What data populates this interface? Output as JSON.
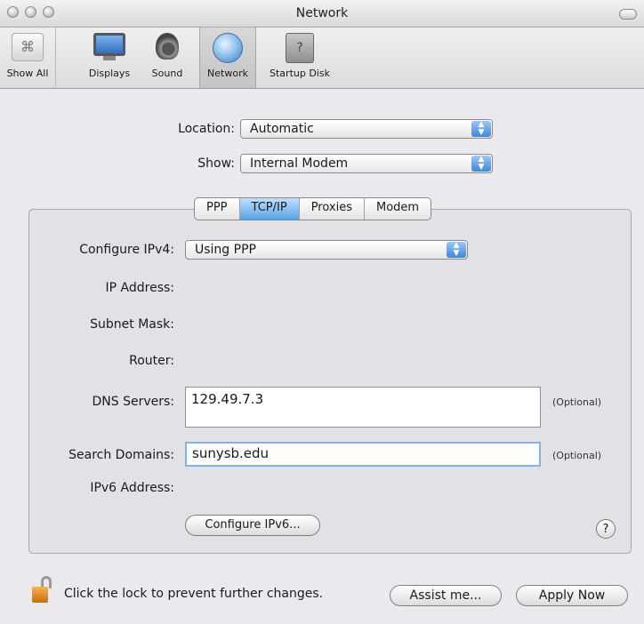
{
  "window": {
    "title": "Network"
  },
  "toolbar": {
    "items": [
      {
        "label": "Show All",
        "icon": "apple-icon"
      },
      {
        "label": "Displays",
        "icon": "display-icon"
      },
      {
        "label": "Sound",
        "icon": "speaker-icon"
      },
      {
        "label": "Network",
        "icon": "network-globe-icon"
      },
      {
        "label": "Startup Disk",
        "icon": "startup-disk-icon"
      }
    ]
  },
  "header": {
    "location_label": "Location:",
    "location_value": "Automatic",
    "show_label": "Show:",
    "show_value": "Internal Modem"
  },
  "tabs": [
    "PPP",
    "TCP/IP",
    "Proxies",
    "Modem"
  ],
  "active_tab": "TCP/IP",
  "form": {
    "configure_ipv4_label": "Configure IPv4:",
    "configure_ipv4_value": "Using PPP",
    "ip_address_label": "IP Address:",
    "subnet_mask_label": "Subnet Mask:",
    "router_label": "Router:",
    "dns_servers_label": "DNS Servers:",
    "dns_servers_value": "129.49.7.3",
    "dns_optional": "(Optional)",
    "search_domains_label": "Search Domains:",
    "search_domains_value": "sunysb.edu",
    "search_optional": "(Optional)",
    "ipv6_label": "IPv6 Address:",
    "configure_ipv6_button": "Configure IPv6...",
    "help_symbol": "?"
  },
  "footer": {
    "lock_text": "Click the lock to prevent further changes.",
    "assist_button": "Assist me...",
    "apply_button": "Apply Now"
  }
}
